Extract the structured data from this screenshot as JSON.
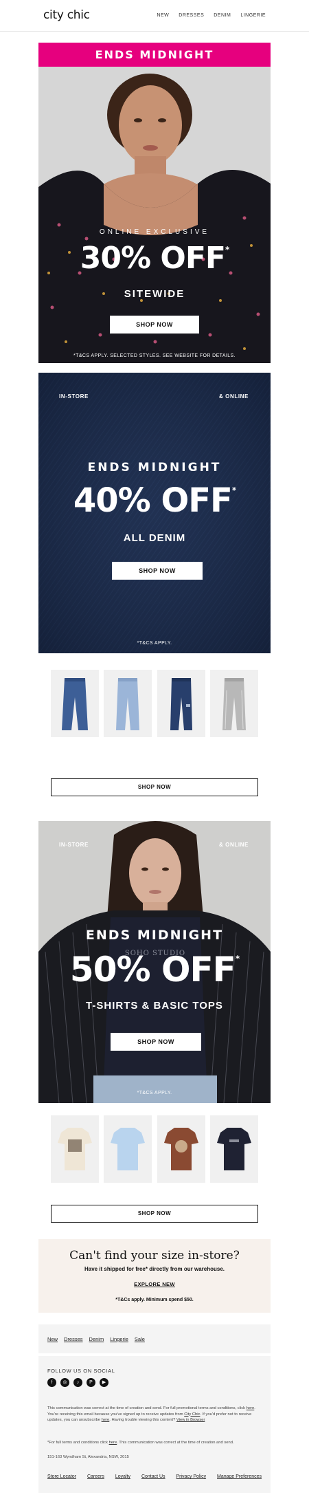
{
  "header": {
    "logo": "city chic",
    "nav": [
      "NEW",
      "DRESSES",
      "DENIM",
      "LINGERIE"
    ]
  },
  "hero1": {
    "banner": "ENDS MIDNIGHT",
    "eyebrow": "ONLINE EXCLUSIVE",
    "headline": "30% OFF",
    "asterisk": "*",
    "subline": "SITEWIDE",
    "button": "SHOP NOW",
    "terms": "*T&CS APPLY. SELECTED STYLES. SEE WEBSITE FOR DETAILS."
  },
  "hero2": {
    "left_tag": "IN-STORE",
    "right_tag": "& ONLINE",
    "eyebrow": "ENDS MIDNIGHT",
    "headline": "40% OFF",
    "asterisk": "*",
    "subline": "ALL DENIM",
    "button": "SHOP NOW",
    "terms": "*T&CS APPLY."
  },
  "denim_products": {
    "button": "SHOP NOW"
  },
  "hero3": {
    "left_tag": "IN-STORE",
    "right_tag": "& ONLINE",
    "eyebrow": "ENDS MIDNIGHT",
    "headline": "50% OFF",
    "asterisk": "*",
    "subline": "T-SHIRTS & BASIC TOPS",
    "shirt_print": "SOHO STUDIO",
    "button": "SHOP NOW",
    "terms": "*T&CS APPLY."
  },
  "tee_products": {
    "button": "SHOP NOW"
  },
  "size_panel": {
    "title": "Can't find your size in-store?",
    "subtitle": "Have it shipped for free* directly from our warehouse.",
    "link": "EXPLORE NEW",
    "note": "*T&Cs apply. Minimum spend $50."
  },
  "footer": {
    "nav": [
      "New",
      "Dresses",
      "Denim",
      "Lingerie",
      "Sale"
    ],
    "follow": "FOLLOW US ON SOCIAL",
    "social": [
      "facebook-icon",
      "instagram-icon",
      "tiktok-icon",
      "pinterest-icon",
      "youtube-icon"
    ],
    "legal1_a": "This communication was correct at the time of creation and send. For full promotional terms and conditions, click",
    "legal1_here": "here",
    "legal1_b": ". You're receiving this email because you've signed up to receive updates from",
    "legal1_brand": "City Chic",
    "legal1_c": ". If you'd prefer not to receive updates, you can unsubscribe",
    "legal1_here2": "here",
    "legal1_d": ". Having trouble viewing this content?",
    "legal1_view": "View in Browser",
    "legal2_a": "*For full terms and conditions click",
    "legal2_here": "here",
    "legal2_b": ". This communication was correct at the time of creation and send.",
    "address": "151-163 Wyndham St, Alexandria, NSW, 2015",
    "bottom_links": [
      "Store Locator",
      "Careers",
      "Loyalty",
      "Contact Us",
      "Privacy Policy",
      "Manage Preferences"
    ]
  }
}
